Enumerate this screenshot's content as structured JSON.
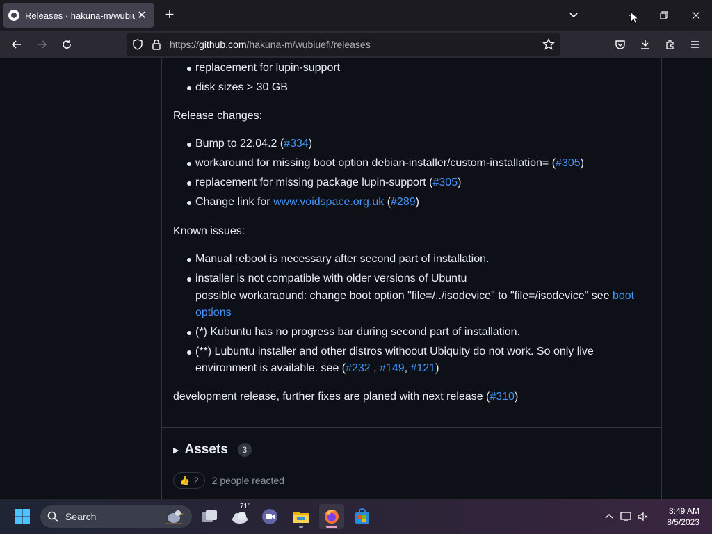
{
  "browser": {
    "tab_title": "Releases · hakuna-m/wubiuefi",
    "url_prefix": "https://",
    "url_host": "github.com",
    "url_path": "/hakuna-m/wubiuefi/releases"
  },
  "release": {
    "top_items": [
      {
        "text": "replacement for lupin-support"
      },
      {
        "text": "disk sizes > 30 GB"
      }
    ],
    "changes_heading": "Release changes:",
    "changes": {
      "c1_text": "Bump to 22.04.2 (",
      "c1_link": "#334",
      "c1_end": ")",
      "c2_text": "workaround for missing boot option debian-installer/custom-installation= (",
      "c2_link": "#305",
      "c2_end": ")",
      "c3_text": "replacement for missing package lupin-support (",
      "c3_link": "#305",
      "c3_end": ")",
      "c4_text": "Change link for ",
      "c4_link1": "www.voidspace.org.uk",
      "c4_mid": " (",
      "c4_link2": "#289",
      "c4_end": ")"
    },
    "issues_heading": "Known issues:",
    "issues": {
      "i1": "Manual reboot is necessary after second part of installation.",
      "i2_line1": "installer is not compatible with older versions of Ubuntu",
      "i2_line2": "possible workaraound: change boot option \"file=/../isodevice\" to \"file=/isodevice\" see ",
      "i2_link": "boot options",
      "i3": "(*) Kubuntu has no progress bar during second part of installation.",
      "i4_text": "(**) Lubuntu installer and other distros withoout Ubiquity do not work. So only live environment is available. see (",
      "i4_l1": "#232",
      "i4_sep1": " , ",
      "i4_l2": "#149",
      "i4_sep2": ", ",
      "i4_l3": "#121",
      "i4_end": ")"
    },
    "dev_text": "development release, further fixes are planed with next release (",
    "dev_link": "#310",
    "dev_end": ")",
    "assets_label": "Assets",
    "assets_count": "3",
    "reaction_count": "2",
    "reaction_text": "2 people reacted"
  },
  "taskbar": {
    "search_label": "Search",
    "weather_temp": "71°",
    "time": "3:49 AM",
    "date": "8/5/2023"
  }
}
